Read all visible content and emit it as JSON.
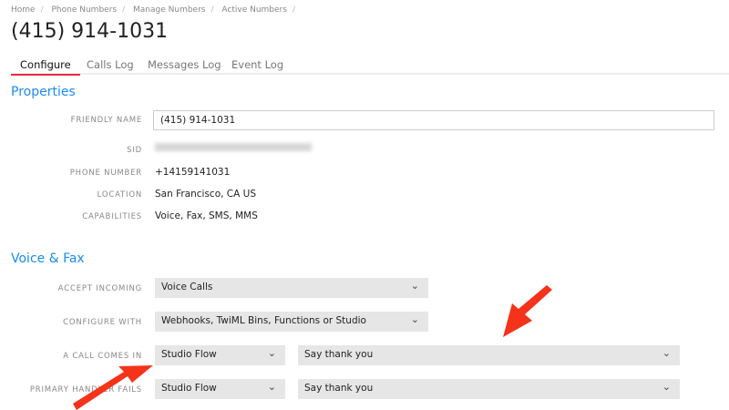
{
  "breadcrumb": [
    "Home",
    "Phone Numbers",
    "Manage Numbers",
    "Active Numbers"
  ],
  "title": "(415) 914-1031",
  "tabs": [
    "Configure",
    "Calls Log",
    "Messages Log",
    "Event Log"
  ],
  "properties": {
    "heading": "Properties",
    "friendly_name_label": "FRIENDLY NAME",
    "friendly_name": "(415) 914-1031",
    "sid_label": "SID",
    "phone_label": "PHONE NUMBER",
    "phone": "+14159141031",
    "location_label": "LOCATION",
    "location": "San Francisco, CA US",
    "capabilities_label": "CAPABILITIES",
    "capabilities": "Voice, Fax, SMS, MMS"
  },
  "voice": {
    "heading": "Voice & Fax",
    "accept_label": "ACCEPT INCOMING",
    "accept": "Voice Calls",
    "configure_label": "CONFIGURE WITH",
    "configure": "Webhooks, TwiML Bins, Functions or Studio",
    "call_label": "A CALL COMES IN",
    "call_type": "Studio Flow",
    "call_flow": "Say thank you",
    "fail_label": "PRIMARY HANDLER FAILS",
    "fail_type": "Studio Flow",
    "fail_flow": "Say thank you"
  },
  "colors": {
    "accent": "#1a8cf0",
    "tab_underline": "#e0313e",
    "arrow": "#f5321a"
  }
}
